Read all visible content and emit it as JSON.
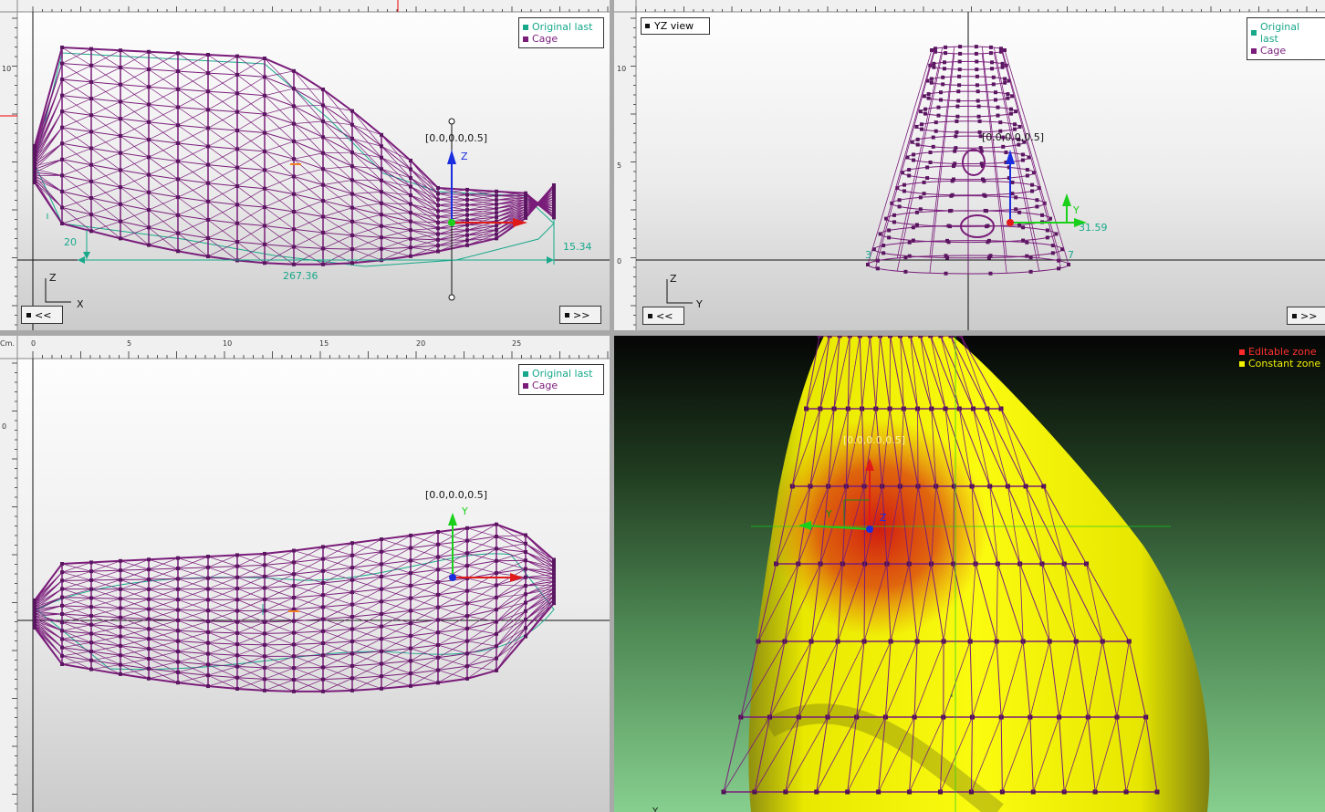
{
  "legend": {
    "original": "Original last",
    "cage": "Cage",
    "original_color": "#18a88a",
    "cage_color": "#7a1d7a"
  },
  "nav": {
    "prev": "<<",
    "next": ">>"
  },
  "ruler": {
    "unit": "Cm.",
    "unit_partial": "cm."
  },
  "xz_view": {
    "top_ruler_ticks": [],
    "left_ticks": [
      "10"
    ],
    "pivot_label": "[0.0,0.0,0.5]",
    "dim_height": "20",
    "dim_length": "267.36",
    "dim_toe": "15.34",
    "axis_up": "Z",
    "axis_right": "X",
    "gizmo_up": "Z"
  },
  "yz_view": {
    "title": "YZ view",
    "left_ticks": [
      "10",
      "5",
      "0"
    ],
    "pivot_label": "[0.0,0.0,0.5]",
    "dim_width": "31.59",
    "dim_left": "3",
    "dim_right": "7",
    "axis_up": "Z",
    "axis_right": "Y",
    "gizmo_up": "Y"
  },
  "xy_view": {
    "top_ruler_ticks": [
      "0",
      "5",
      "10",
      "15",
      "20",
      "25"
    ],
    "left_ticks": [
      "0"
    ],
    "pivot_label": "[0.0,0.0,0.5]",
    "gizmo_up": "Y"
  },
  "persp_view": {
    "editable": "Editable zone",
    "constant": "Constant zone",
    "editable_color": "#ff2a2a",
    "constant_color": "#f2f200",
    "pivot_label": "[0.0,0.0,0.5]",
    "axis_y": "Y",
    "axis_z": "Z",
    "corner_label": "Y"
  }
}
